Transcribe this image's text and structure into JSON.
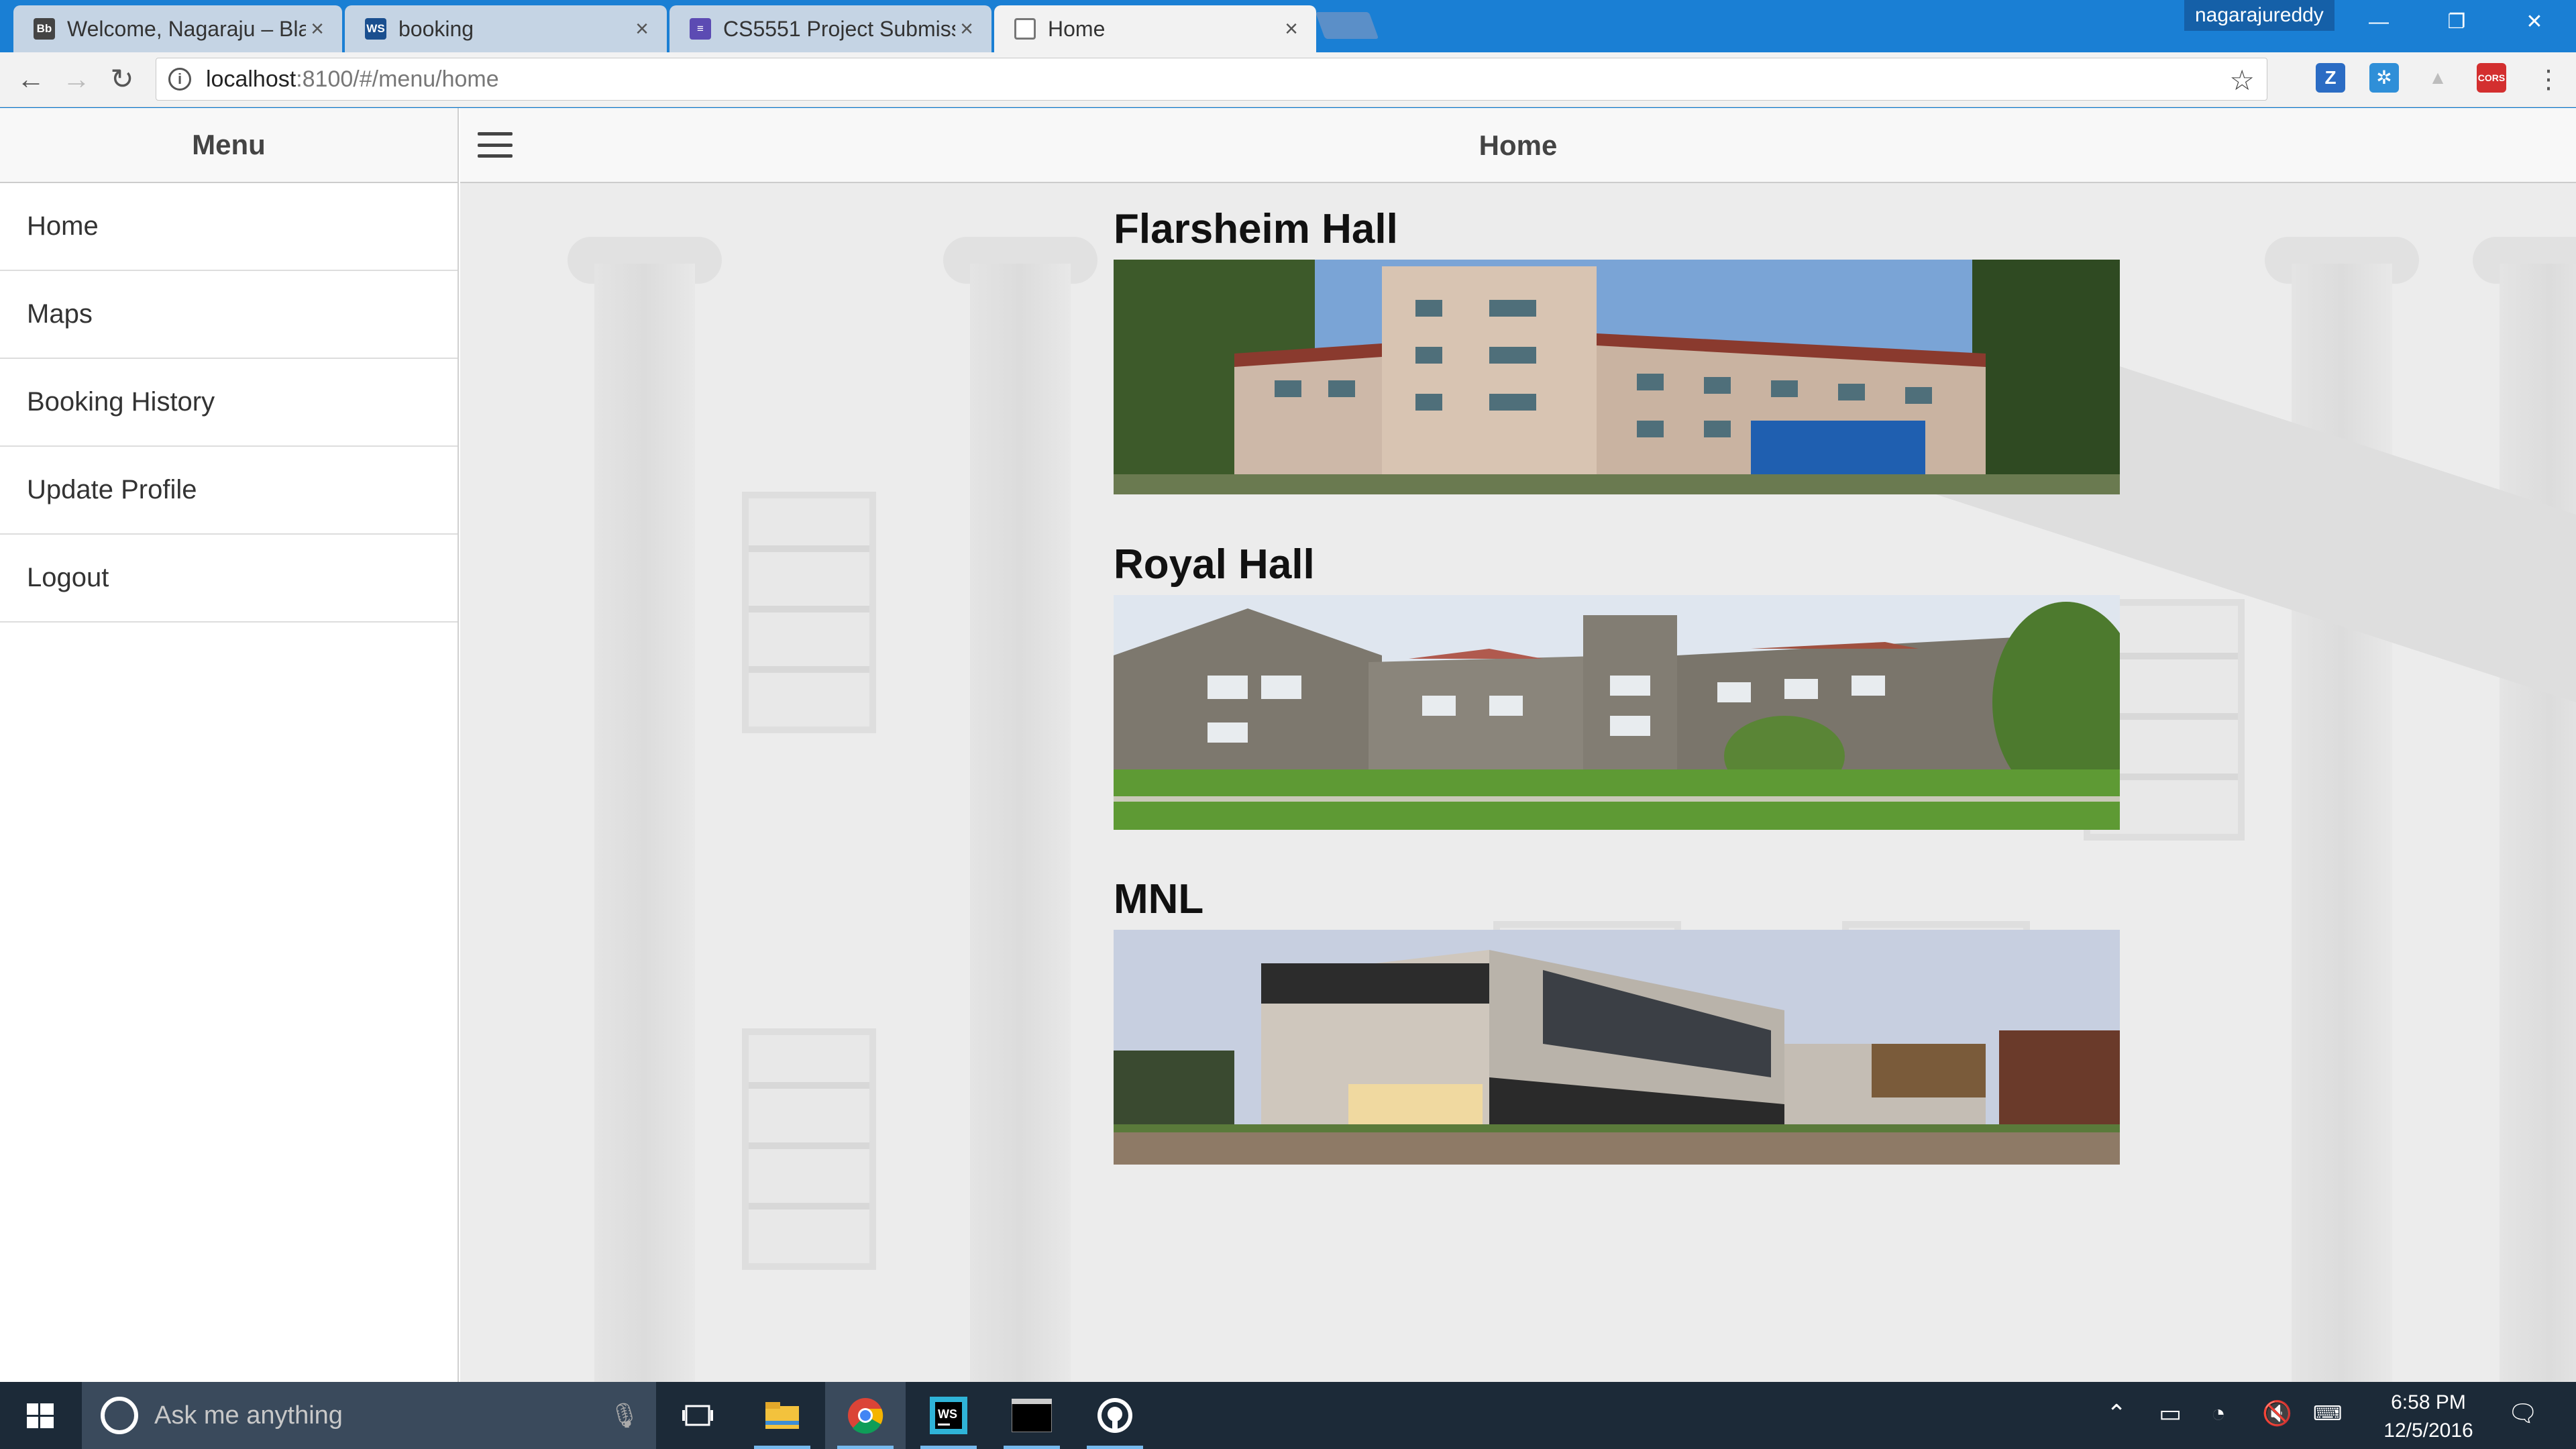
{
  "browser": {
    "tabs": [
      {
        "title": "Welcome, Nagaraju – Bla",
        "favicon": "blackboard-icon",
        "active": false
      },
      {
        "title": "booking",
        "favicon": "webstorm-icon",
        "active": false
      },
      {
        "title": "CS5551 Project Submissi",
        "favicon": "forms-icon",
        "active": false
      },
      {
        "title": "Home",
        "favicon": "page-icon",
        "active": true
      }
    ],
    "tab_close_glyph": "×",
    "profile_name": "nagarajureddy",
    "url_host": "localhost",
    "url_path": ":8100/#/menu/home",
    "extensions": [
      {
        "label": "Z",
        "color": "#2b6cc4"
      },
      {
        "label": "✲",
        "color": "#2f8fd8"
      },
      {
        "label": "▲",
        "color": "#bdbdbd"
      },
      {
        "label": "CORS",
        "color": "#d32f2f"
      }
    ]
  },
  "app": {
    "menu_title": "Menu",
    "menu_items": [
      "Home",
      "Maps",
      "Booking History",
      "Update Profile",
      "Logout"
    ],
    "page_title": "Home",
    "buildings": [
      {
        "name": "Flarsheim Hall"
      },
      {
        "name": "Royal Hall"
      },
      {
        "name": "MNL"
      }
    ]
  },
  "taskbar": {
    "search_placeholder": "Ask me anything",
    "time": "6:58 PM",
    "date": "12/5/2016",
    "apps": [
      "file-explorer",
      "chrome",
      "webstorm",
      "terminal",
      "github"
    ]
  }
}
